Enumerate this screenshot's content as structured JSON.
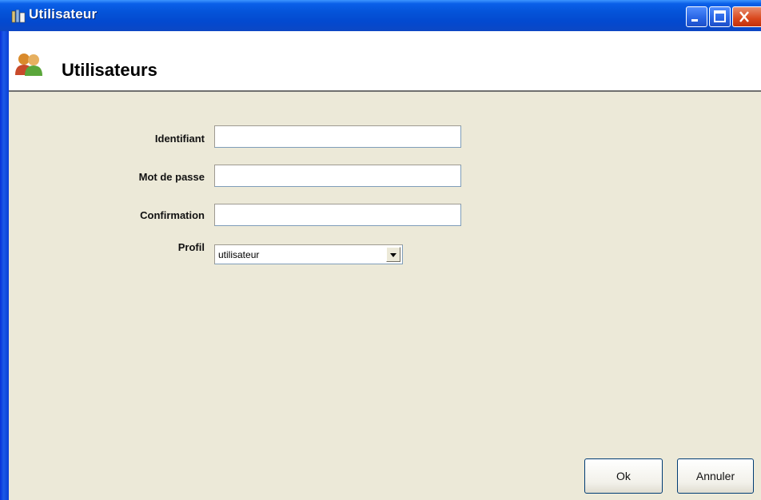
{
  "window": {
    "title": "Utilisateur"
  },
  "header": {
    "title": "Utilisateurs"
  },
  "form": {
    "identifiant": {
      "label": "Identifiant",
      "value": ""
    },
    "mot_de_passe": {
      "label": "Mot de passe",
      "value": ""
    },
    "confirmation": {
      "label": "Confirmation",
      "value": ""
    },
    "profil": {
      "label": "Profil",
      "selected": "utilisateur"
    }
  },
  "buttons": {
    "ok": "Ok",
    "cancel": "Annuler"
  },
  "icons": {
    "app": "app-icon",
    "users": "users-icon",
    "minimize": "minimize-icon",
    "maximize": "maximize-icon",
    "close": "close-icon"
  }
}
